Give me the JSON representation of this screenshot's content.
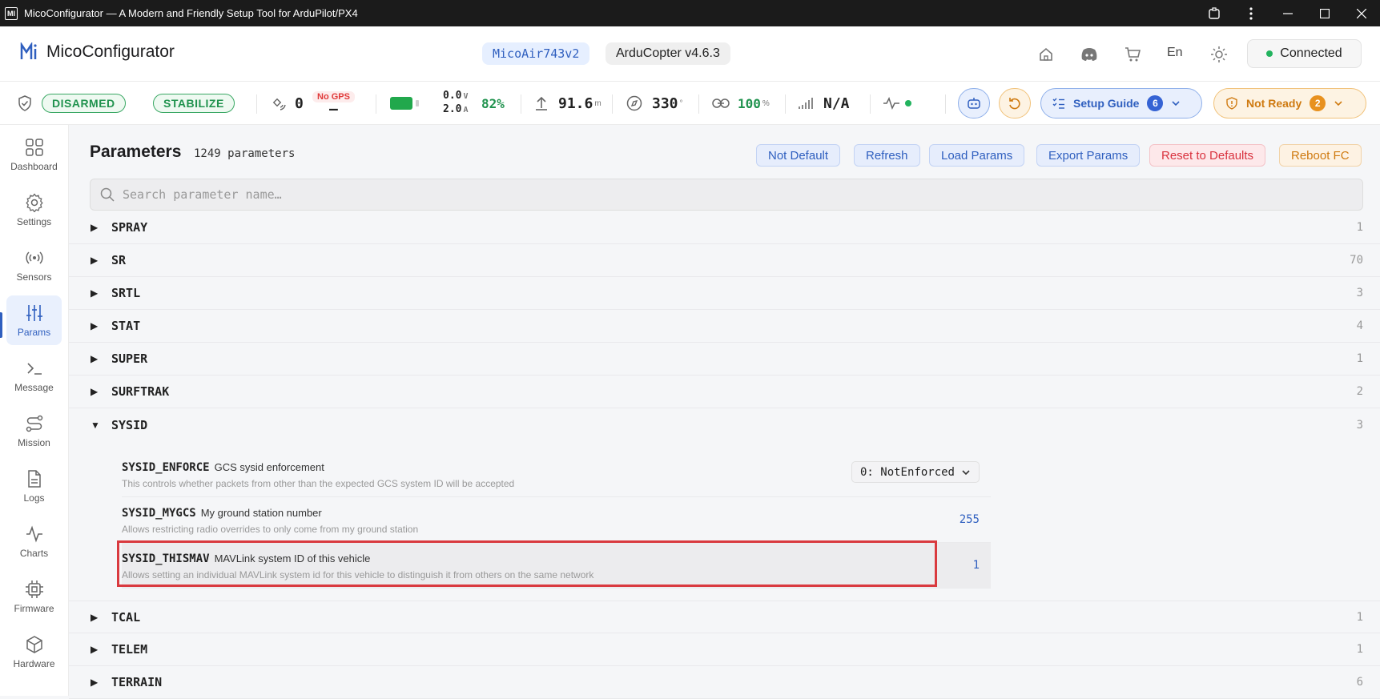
{
  "window": {
    "title": "MicoConfigurator — A Modern and Friendly Setup Tool for ArduPilot/PX4",
    "app_icon": "MI"
  },
  "header": {
    "brand": "MicoConfigurator",
    "board": "MicoAir743v2",
    "firmware": "ArduCopter v4.6.3",
    "language": "En",
    "connection": "Connected"
  },
  "status": {
    "arm_state": "DISARMED",
    "flight_mode": "STABILIZE",
    "satellites": "0",
    "gps_label": "No GPS",
    "gps_fix": "–",
    "voltage": "0.0",
    "voltage_unit": "V",
    "current": "2.0",
    "current_unit": "A",
    "battery_pct": "82%",
    "altitude": "91.6",
    "altitude_unit": "m",
    "heading": "330",
    "heading_unit": "°",
    "link_quality": "100",
    "link_unit": "%",
    "rssi": "N/A",
    "setup_guide_label": "Setup Guide",
    "setup_guide_count": "6",
    "not_ready_label": "Not Ready",
    "not_ready_count": "2",
    "colors": {
      "ok": "#21934f",
      "warn": "#cf7a10",
      "accent": "#2f5fbf"
    }
  },
  "sidebar": {
    "items": [
      {
        "label": "Dashboard",
        "icon": "grid-icon"
      },
      {
        "label": "Settings",
        "icon": "gear-icon"
      },
      {
        "label": "Sensors",
        "icon": "broadcast-icon"
      },
      {
        "label": "Params",
        "icon": "sliders-icon"
      },
      {
        "label": "Message",
        "icon": "terminal-icon"
      },
      {
        "label": "Mission",
        "icon": "route-icon"
      },
      {
        "label": "Logs",
        "icon": "file-icon"
      },
      {
        "label": "Charts",
        "icon": "activity-icon"
      },
      {
        "label": "Firmware",
        "icon": "chip-icon"
      },
      {
        "label": "Hardware",
        "icon": "box-icon"
      }
    ]
  },
  "params": {
    "title": "Parameters",
    "count_text": "1249 parameters",
    "toolbar": {
      "not_default": "Not Default",
      "refresh": "Refresh",
      "load": "Load Params",
      "export": "Export Params",
      "reset": "Reset to Defaults",
      "reboot": "Reboot FC"
    },
    "search_placeholder": "Search parameter name…",
    "groups_before": [
      {
        "name": "SPRAY",
        "count": "1"
      },
      {
        "name": "SR",
        "count": "70"
      },
      {
        "name": "SRTL",
        "count": "3"
      },
      {
        "name": "STAT",
        "count": "4"
      },
      {
        "name": "SUPER",
        "count": "1"
      },
      {
        "name": "SURFTRAK",
        "count": "2"
      }
    ],
    "expanded_group": {
      "name": "SYSID",
      "count": "3"
    },
    "sysid_params": [
      {
        "name": "SYSID_ENFORCE",
        "short": "GCS sysid enforcement",
        "desc": "This controls whether packets from other than the expected GCS system ID will be accepted",
        "value": "0: NotEnforced"
      },
      {
        "name": "SYSID_MYGCS",
        "short": "My ground station number",
        "desc": "Allows restricting radio overrides to only come from my ground station",
        "value": "255"
      },
      {
        "name": "SYSID_THISMAV",
        "short": "MAVLink system ID of this vehicle",
        "desc": "Allows setting an individual MAVLink system id for this vehicle to distinguish it from others on the same network",
        "value": "1"
      }
    ],
    "groups_after": [
      {
        "name": "TCAL",
        "count": "1"
      },
      {
        "name": "TELEM",
        "count": "1"
      },
      {
        "name": "TERRAIN",
        "count": "6"
      }
    ]
  }
}
